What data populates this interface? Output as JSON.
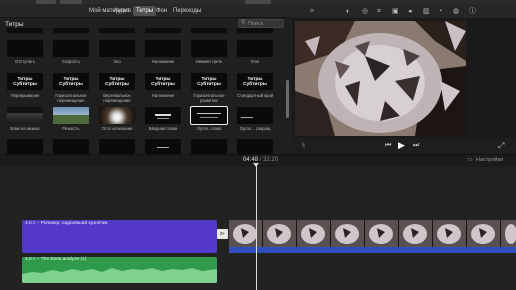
{
  "nav": {
    "tabs": [
      {
        "label": "Мой материал"
      },
      {
        "label": "Аудио"
      },
      {
        "label": "Титры",
        "active": true
      },
      {
        "label": "Фон"
      },
      {
        "label": "Переходы"
      }
    ]
  },
  "browser": {
    "title": "Титры",
    "search_placeholder": "Поиск",
    "rows": [
      {
        "tiles": [
          {
            "label": "Отступать",
            "text": ""
          },
          {
            "label": "Скорость",
            "text": ""
          },
          {
            "label": "Эхо",
            "text": ""
          },
          {
            "label": "Наложение",
            "text": ""
          },
          {
            "label": "Нижняя треть",
            "text": ""
          },
          {
            "label": "Угол",
            "text": ""
          }
        ]
      },
      {
        "tiles": [
          {
            "label": "Перекрывание",
            "text": "Титры Субтитры"
          },
          {
            "label": "Горизонтальное перемещение",
            "text": "Титры Субтитры"
          },
          {
            "label": "Вертикальное перемещение",
            "text": "Титры Субтитры"
          },
          {
            "label": "Наложение",
            "text": "Титры Субтитры"
          },
          {
            "label": "Горизонтальное развитие",
            "text": "Титры Субтитры"
          },
          {
            "label": "Стандартный край",
            "text": "Титры Субтитры"
          }
        ]
      },
      {
        "tiles": [
          {
            "label": "Блик на низках",
            "text": ""
          },
          {
            "label": "Резкость",
            "text": ""
          },
          {
            "label": "Отсл исчезание",
            "text": ""
          },
          {
            "label": "Вводная глава",
            "text": ""
          },
          {
            "label": "Оугол, главо",
            "text": "",
            "selected": true
          },
          {
            "label": "Оугол... сокращ",
            "text": ""
          }
        ]
      }
    ]
  },
  "viewer": {
    "tools": [
      "magic-wand-icon",
      "color-balance-icon",
      "color-correction-icon",
      "crop-icon",
      "stabilization-icon",
      "volume-icon",
      "equalizer-icon",
      "speed-icon",
      "noise-icon",
      "info-icon"
    ],
    "controls": [
      "microphone-icon",
      "skip-back-icon",
      "play-icon",
      "skip-forward-icon",
      "fullscreen-icon"
    ]
  },
  "timeline": {
    "current_time": "04:48",
    "separator": "/",
    "total_time": "32:20",
    "settings_label": "Настройки",
    "title_clip_label": "4,0 с – Роликер: надоевший кузнечик",
    "audio_clip_label": "4,0 с – The Enes analyze (1)",
    "transition_symbol": "⧐"
  },
  "colors": {
    "title_clip": "#5438c8",
    "audio_clip": "#2f9a4a",
    "blue_bar": "#2f4fbf"
  }
}
